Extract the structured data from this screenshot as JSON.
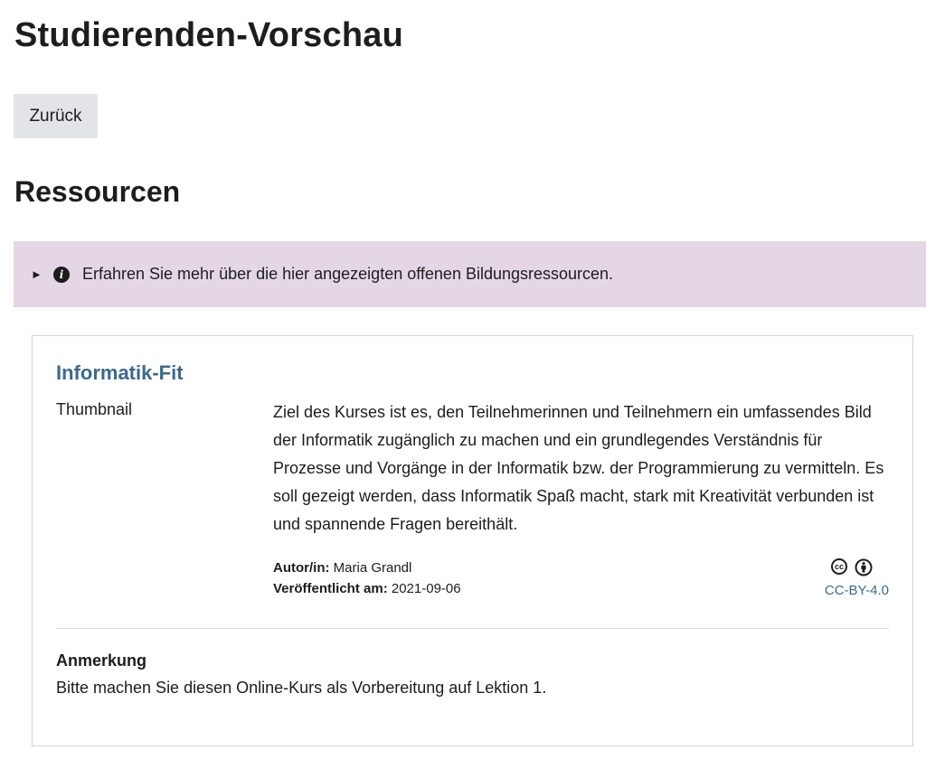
{
  "page": {
    "title": "Studierenden-Vorschau",
    "back_label": "Zurück",
    "section_title": "Ressourcen"
  },
  "info_box": {
    "text": "Erfahren Sie mehr über die hier angezeigten offenen Bildungsressourcen.",
    "icon": "info-icon",
    "background": "#e4d6e4"
  },
  "resource": {
    "title": "Informatik-Fit",
    "thumbnail_label": "Thumbnail",
    "description": "Ziel des Kurses ist es, den Teilnehmerinnen und Teilnehmern ein umfassendes Bild der Informatik zugänglich zu machen und ein grundlegendes Verständnis für Prozesse und Vorgänge in der Informatik bzw. der Programmierung zu vermitteln. Es soll gezeigt werden, dass Informatik Spaß macht, stark mit Kreativität verbunden ist und spannende Fragen bereithält.",
    "author_label": "Autor/in:",
    "author": "Maria Grandl",
    "published_label": "Veröffentlicht am:",
    "published": "2021-09-06",
    "license": "CC-BY-4.0",
    "license_icons": [
      "cc-icon",
      "by-icon"
    ],
    "note_title": "Anmerkung",
    "note_text": "Bitte machen Sie diesen Online-Kurs als Vorbereitung auf Lektion 1."
  },
  "colors": {
    "accent_link": "#3b6a8c",
    "button_bg": "#e2e4e8"
  }
}
